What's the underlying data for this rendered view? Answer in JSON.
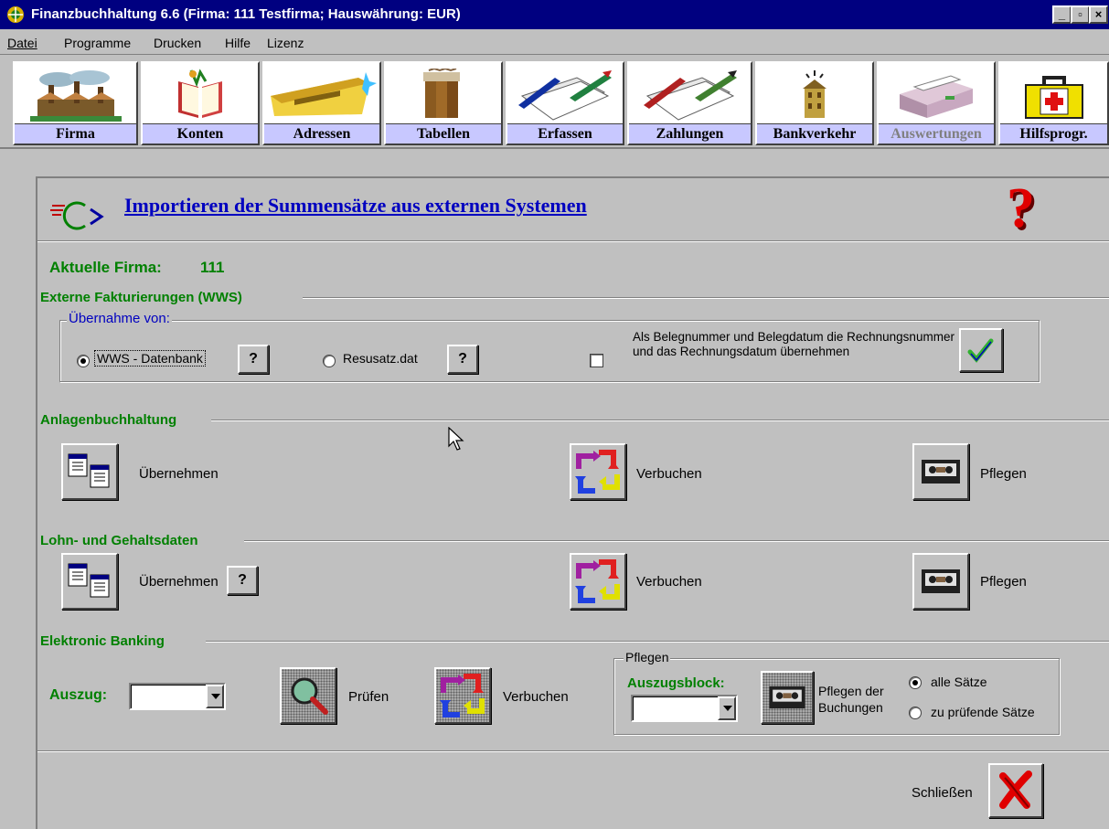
{
  "window": {
    "title": "Finanzbuchhaltung 6.6  (Firma: 111 Testfirma;   Hauswährung: EUR)",
    "controls": {
      "minimize": "_",
      "maximize": "▫",
      "close": "×"
    }
  },
  "menu": [
    {
      "label": "Datei",
      "mnemonic": "D"
    },
    {
      "label": "Programme",
      "mnemonic": "P"
    },
    {
      "label": "Drucken",
      "mnemonic": ""
    },
    {
      "label": "Hilfe",
      "mnemonic": ""
    },
    {
      "label": "Lizenz",
      "mnemonic": ""
    }
  ],
  "toolbar": [
    {
      "label": "Firma",
      "icon": "factory-icon",
      "enabled": true
    },
    {
      "label": "Konten",
      "icon": "book-icon",
      "enabled": true
    },
    {
      "label": "Adressen",
      "icon": "envelope-icon",
      "enabled": true
    },
    {
      "label": "Tabellen",
      "icon": "binders-icon",
      "enabled": true
    },
    {
      "label": "Erfassen",
      "icon": "papers-pen-icon",
      "enabled": true
    },
    {
      "label": "Zahlungen",
      "icon": "payments-icon",
      "enabled": true
    },
    {
      "label": "Bankverkehr",
      "icon": "bank-icon",
      "enabled": true
    },
    {
      "label": "Auswertungen",
      "icon": "printer-icon",
      "enabled": false
    },
    {
      "label": "Hilfsprogr.",
      "icon": "first-aid-icon",
      "enabled": true
    }
  ],
  "dialog": {
    "title": "Importieren der Summensätze aus externen Systemen",
    "help_glyph": "?",
    "firma_label": "Aktuelle Firma:",
    "firma_value": "111",
    "wws": {
      "section": "Externe Fakturierungen (WWS)",
      "group": "Übernahme von:",
      "option_db": "WWS - Datenbank",
      "option_file": "Resusatz.dat",
      "selected": "WWS - Datenbank",
      "checkbox_label": "Als Belegnummer und Belegdatum die Rechnungsnummer und das Rechnungsdatum übernehmen",
      "checkbox_checked": false,
      "help_btn": "?"
    },
    "anlagen": {
      "section": "Anlagenbuchhaltung",
      "uebernehmen": "Übernehmen",
      "verbuchen": "Verbuchen",
      "pflegen": "Pflegen"
    },
    "lohn": {
      "section": "Lohn- und Gehaltsdaten",
      "uebernehmen": "Übernehmen",
      "help_btn": "?",
      "verbuchen": "Verbuchen",
      "pflegen": "Pflegen"
    },
    "banking": {
      "section": "Elektronic Banking",
      "auszug_label": "Auszug:",
      "auszug_value": "",
      "pruefen": "Prüfen",
      "verbuchen": "Verbuchen",
      "pflegen_group": "Pflegen",
      "auszugsblock_label": "Auszugsblock:",
      "auszugsblock_value": "",
      "pflegen_buchungen": "Pflegen der Buchungen",
      "radio_all": "alle Sätze",
      "radio_check": "zu prüfende Sätze",
      "selected": "alle Sätze"
    },
    "close_label": "Schließen"
  },
  "colors": {
    "titlebar": "#000080",
    "label_green": "#008000",
    "link_blue": "#0000c0",
    "toolbar_label_bg": "#c8c8ff"
  }
}
